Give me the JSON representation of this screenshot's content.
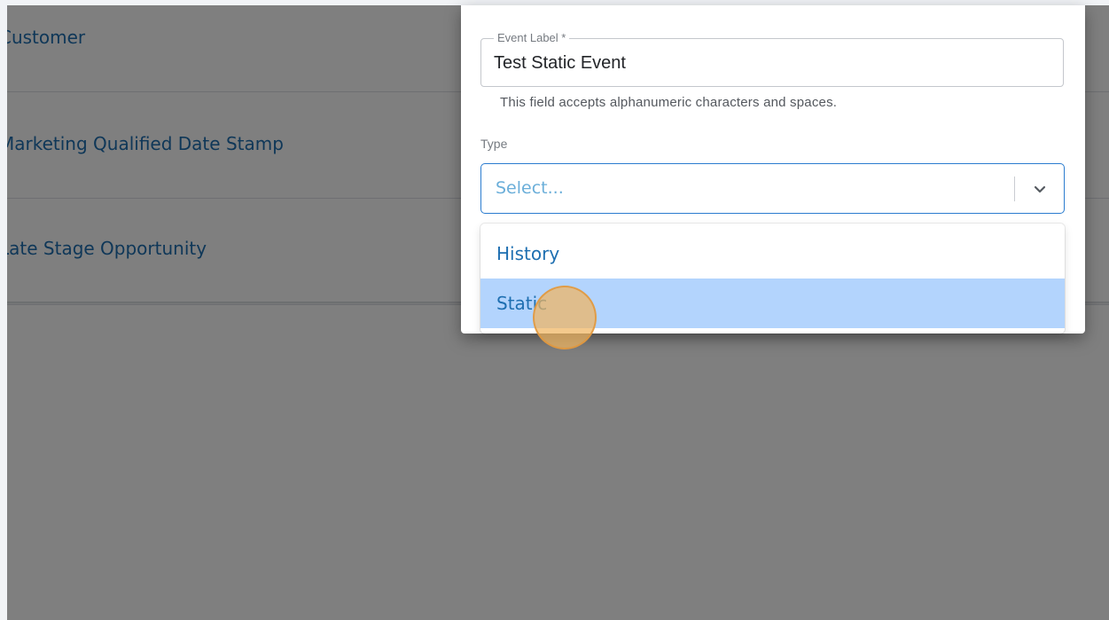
{
  "background_list": {
    "rows": [
      {
        "label": "Customer"
      },
      {
        "label": "Marketing Qualified Date Stamp"
      },
      {
        "label": "Late Stage Opportunity"
      }
    ]
  },
  "modal": {
    "event_label_field": {
      "label": "Event Label *",
      "value": "Test Static Event",
      "helper": "This field accepts alphanumeric characters and spaces."
    },
    "type_field": {
      "label": "Type",
      "placeholder": "Select...",
      "options": [
        {
          "label": "History",
          "focused": false
        },
        {
          "label": "Static",
          "focused": true
        }
      ]
    }
  },
  "colors": {
    "link_blue": "#1e6fb1",
    "focus_border": "#2b7ccf",
    "option_highlight": "#b3d4fd",
    "overlay": "rgba(0,0,0,0.5)",
    "click_marker": "#f0b45f"
  }
}
